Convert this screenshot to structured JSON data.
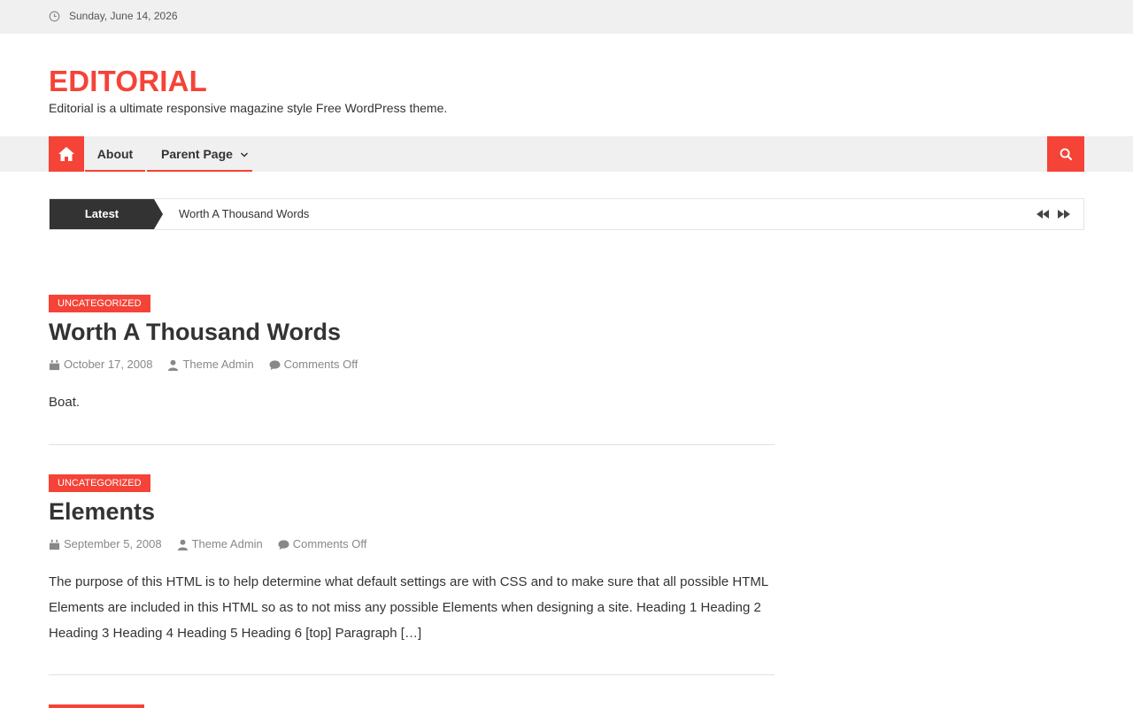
{
  "topbar": {
    "date": "Sunday, June 14, 2026",
    "icon": "clock-icon"
  },
  "site": {
    "title": "EDITORIAL",
    "description": "Editorial is a ultimate responsive magazine style Free WordPress theme."
  },
  "nav": {
    "home_icon": "home-icon",
    "items": [
      {
        "label": "About"
      },
      {
        "label": "Parent Page"
      }
    ],
    "search_icon": "search-icon"
  },
  "ticker": {
    "label": "Latest",
    "item": "Worth A Thousand Words",
    "prev_icon": "rewind-icon",
    "next_icon": "fast-forward-icon"
  },
  "posts": [
    {
      "category": "UNCATEGORIZED",
      "title": "Worth A Thousand Words",
      "date": "October 17, 2008",
      "author": "Theme Admin",
      "comments": "Comments Off",
      "excerpt": "Boat."
    },
    {
      "category": "UNCATEGORIZED",
      "title": "Elements",
      "date": "September 5, 2008",
      "author": "Theme Admin",
      "comments": "Comments Off",
      "excerpt": "The purpose of this HTML is to help determine what default settings are with CSS and to make sure that all possible HTML Elements are included in this HTML so as to not miss any possible Elements when designing a site. Heading 1 Heading 2 Heading 3 Heading 4 Heading 5 Heading 6 [top] Paragraph […]"
    }
  ],
  "colors": {
    "accent": "#f54337",
    "dark": "#333333",
    "light_bg": "#f0f0f0"
  }
}
